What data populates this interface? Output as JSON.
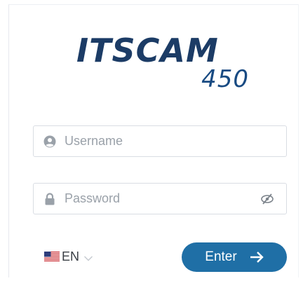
{
  "logo": {
    "brand": "ITSCAM",
    "model": "450"
  },
  "form": {
    "username": {
      "placeholder": "Username",
      "value": ""
    },
    "password": {
      "placeholder": "Password",
      "value": ""
    }
  },
  "language": {
    "code": "EN",
    "flag": "us-flag-icon"
  },
  "actions": {
    "enter_label": "Enter"
  },
  "colors": {
    "brand_dark": "#1c3c66",
    "button": "#1f6fa6"
  }
}
